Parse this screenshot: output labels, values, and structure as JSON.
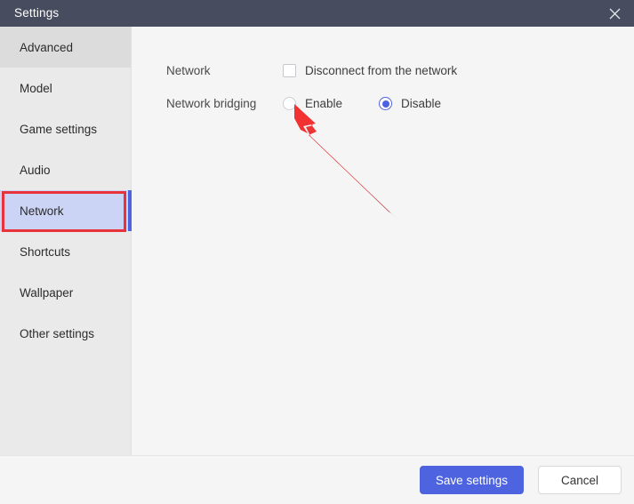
{
  "window": {
    "title": "Settings",
    "close_icon": "close-icon"
  },
  "sidebar": {
    "items": [
      {
        "label": "Advanced",
        "state": "hovered"
      },
      {
        "label": "Model",
        "state": "normal"
      },
      {
        "label": "Game settings",
        "state": "normal"
      },
      {
        "label": "Audio",
        "state": "normal"
      },
      {
        "label": "Network",
        "state": "selected"
      },
      {
        "label": "Shortcuts",
        "state": "normal"
      },
      {
        "label": "Wallpaper",
        "state": "normal"
      },
      {
        "label": "Other settings",
        "state": "normal"
      }
    ]
  },
  "content": {
    "network_row": {
      "label": "Network",
      "checkbox_label": "Disconnect from the network",
      "checked": false
    },
    "bridging_row": {
      "label": "Network bridging",
      "options": [
        {
          "label": "Enable",
          "selected": false
        },
        {
          "label": "Disable",
          "selected": true
        }
      ]
    }
  },
  "footer": {
    "save_label": "Save settings",
    "cancel_label": "Cancel"
  },
  "annotations": {
    "highlight_target": "Network",
    "arrow_target": "Enable",
    "color": "#e8333a"
  },
  "colors": {
    "titlebar": "#474c5e",
    "sidebar": "#eaeaea",
    "content": "#f5f5f6",
    "accent": "#4d63e0",
    "selected_item": "#ccd4f5",
    "annotation": "#e8333a"
  }
}
